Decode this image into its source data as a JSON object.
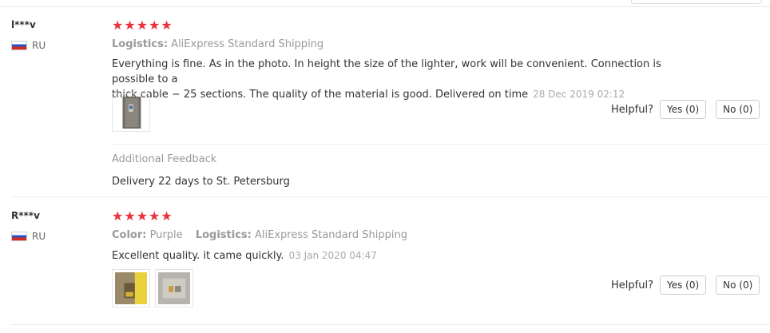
{
  "reviews": [
    {
      "user": "l***v",
      "country": "RU",
      "stars": "★★★★★",
      "logistics_label": "Logistics:",
      "logistics_value": "AliExpress Standard Shipping",
      "text_line1": "Everything is fine. As in the photo. In height the size of the lighter, work will be convenient. Connection is possible to a",
      "text_line2": "thick cable − 25 sections. The quality of the material is good. Delivered on time",
      "date": "28 Dec 2019 02:12",
      "helpful_label": "Helpful?",
      "yes_label": "Yes (0)",
      "no_label": "No (0)",
      "additional_title": "Additional Feedback",
      "additional_text": "Delivery 22 days to St. Petersburg"
    },
    {
      "user": "R***v",
      "country": "RU",
      "stars": "★★★★★",
      "color_label": "Color:",
      "color_value": "Purple",
      "logistics_label": "Logistics:",
      "logistics_value": "AliExpress Standard Shipping",
      "text_line1": "Excellent quality. it came quickly.",
      "date": "03 Jan 2020 04:47",
      "helpful_label": "Helpful?",
      "yes_label": "Yes (0)",
      "no_label": "No (0)"
    }
  ],
  "colors": {
    "star": "#e8333f",
    "muted": "#999999",
    "text": "#333333"
  }
}
